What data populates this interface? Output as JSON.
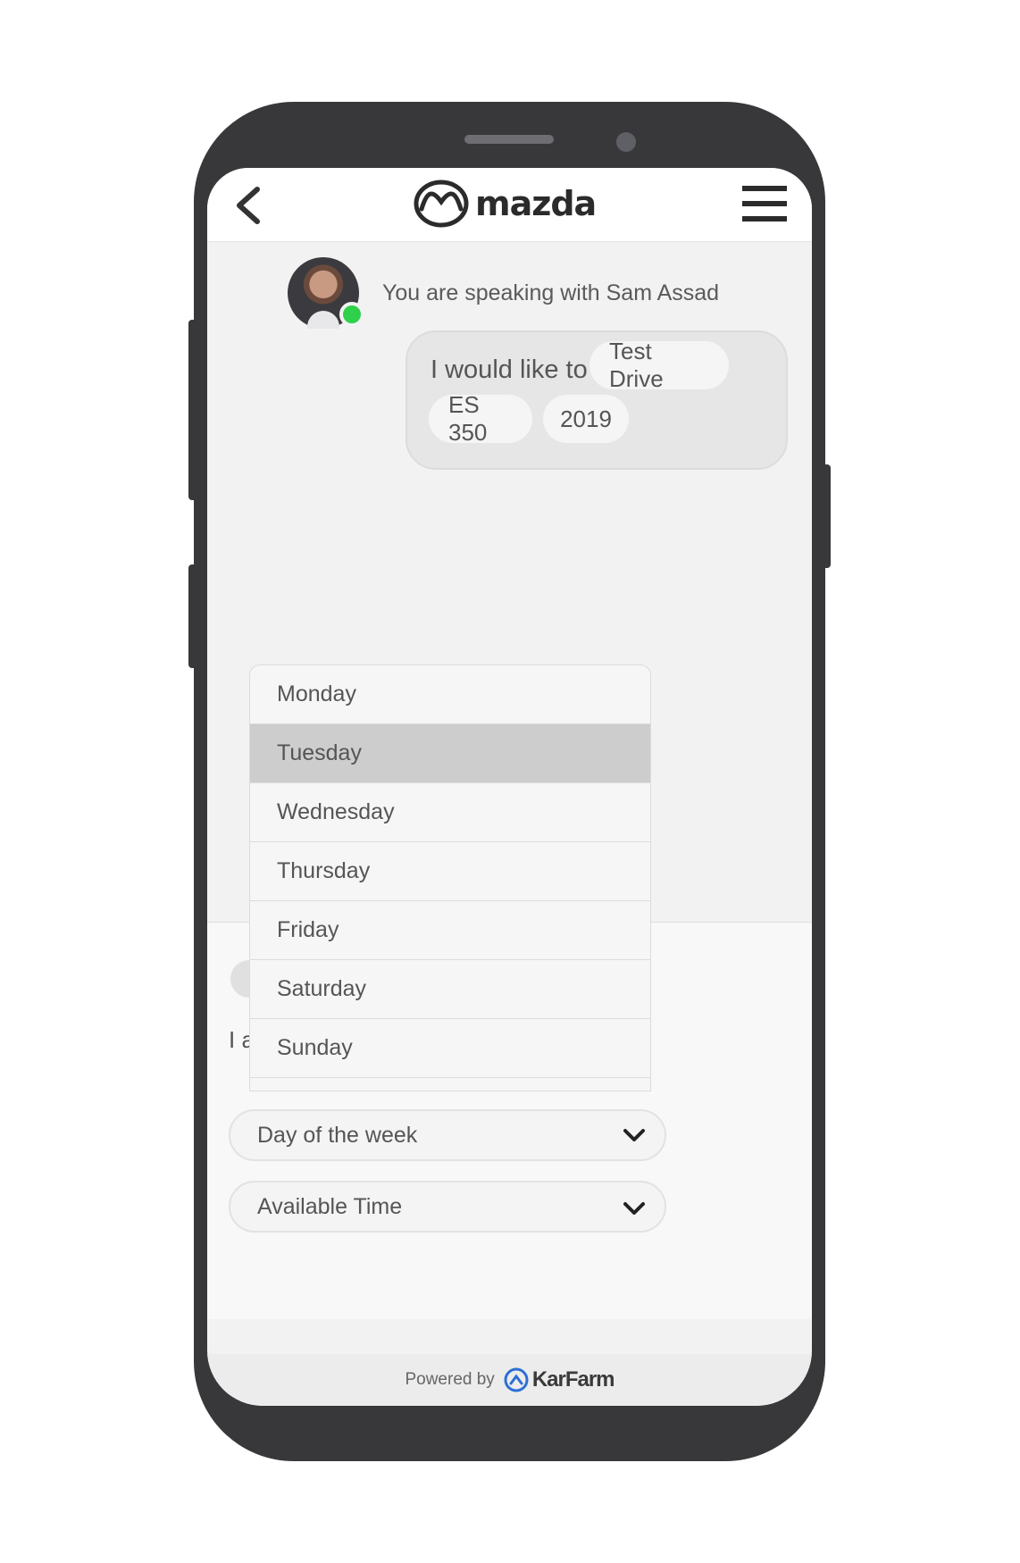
{
  "header": {
    "back_icon": "chevron-left-icon",
    "brand": "mazda",
    "menu_icon": "hamburger-menu-icon"
  },
  "agent": {
    "status_text": "You are speaking with Sam Assad",
    "status_color": "#2fd14b"
  },
  "bubble": {
    "prefix": "I would like to",
    "chips": [
      "Test Drive",
      "ES 350",
      "2019"
    ]
  },
  "background": {
    "partial_text": "I a"
  },
  "dropdown": {
    "options": [
      "Monday",
      "Tuesday",
      "Wednesday",
      "Thursday",
      "Friday",
      "Saturday",
      "Sunday"
    ],
    "highlighted": "Tuesday"
  },
  "selects": {
    "day_placeholder": "Day of the week",
    "time_placeholder": "Available Time"
  },
  "footer": {
    "powered_by": "Powered by",
    "brand": "KarFarm",
    "brand_color": "#2d6fd6"
  }
}
